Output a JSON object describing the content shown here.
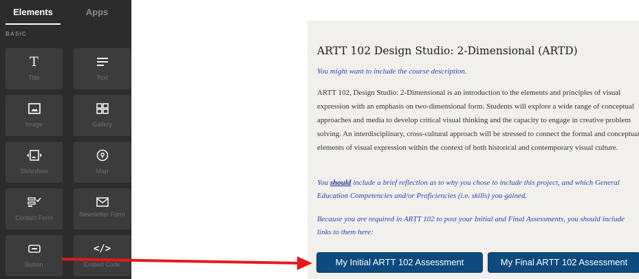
{
  "panel": {
    "tabs": [
      "Elements",
      "Apps"
    ],
    "section_label": "BASIC",
    "tiles": [
      {
        "icon": "title-icon",
        "glyph": "T",
        "label": "Title"
      },
      {
        "icon": "text-icon",
        "glyph": "≡",
        "label": "Text"
      },
      {
        "icon": "image-icon",
        "glyph": "",
        "label": "Image"
      },
      {
        "icon": "gallery-icon",
        "glyph": "",
        "label": "Gallery"
      },
      {
        "icon": "slideshow-icon",
        "glyph": "",
        "label": "Slideshow"
      },
      {
        "icon": "map-icon",
        "glyph": "",
        "label": "Map"
      },
      {
        "icon": "contact-form-icon",
        "glyph": "",
        "label": "Contact Form"
      },
      {
        "icon": "newsletter-icon",
        "glyph": "",
        "label": "Newsletter Form"
      },
      {
        "icon": "button-icon",
        "glyph": "",
        "label": "Button"
      },
      {
        "icon": "embed-code-icon",
        "glyph": "</>",
        "label": "Embed Code"
      }
    ]
  },
  "doc": {
    "title": "ARTT 102  Design Studio: 2-Dimensional (ARTD)",
    "note": "You might want to include the course description.",
    "body": "ARTT 102, Design Studio: 2-Dimensional is an introduction to the elements and principles of visual expression with an emphasis on two-dimensional form. Students will explore a wide range of conceptual approaches and media to develop critical visual thinking and the capacity to engage in creative problem solving. An interdisciplinary, cross-cultural approach will be stressed to connect the formal and conceptual elements of visual expression within the context of both historical and contemporary visual culture.",
    "reflect_prefix": "You ",
    "reflect_emphasis": "should",
    "reflect_suffix": " include a brief reflection as to why you chose to include this project, and which General Education Competencies and/or Proficiencies (i.e. skills) you gained.",
    "links_note": "Because you are required in ARTT 102 to post your Initial and Final Assessments, you should include links to them here:",
    "buttons": [
      "My Initial ARTT 102 Assessment",
      "My Final ARTT 102 Assessment"
    ]
  },
  "colors": {
    "panel_bg": "#2c2c2c",
    "tile_bg": "#3c3c3c",
    "button_bg": "#0e4a7e",
    "arrow": "#e8181b",
    "italic_blue": "#2e3fb3"
  }
}
